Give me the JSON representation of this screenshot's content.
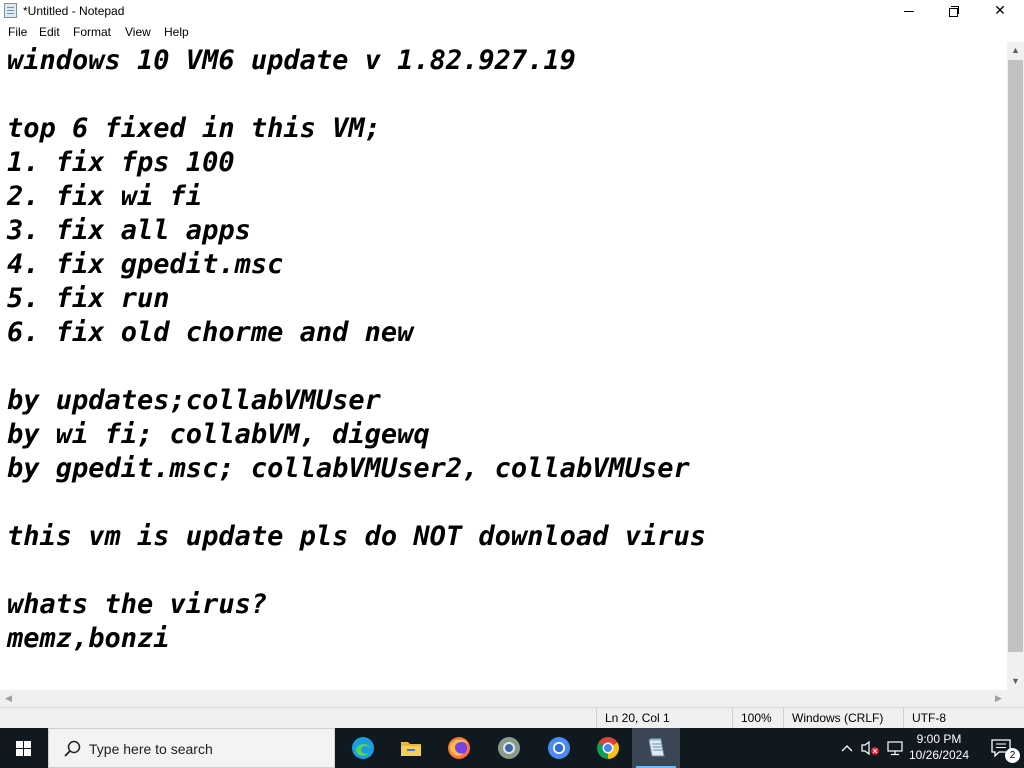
{
  "window": {
    "title": "*Untitled - Notepad",
    "controls": {
      "minimize": "minimize",
      "restore": "restore",
      "close": "close"
    }
  },
  "menu": {
    "items": [
      "File",
      "Edit",
      "Format",
      "View",
      "Help"
    ]
  },
  "editor": {
    "content": "windows 10 VM6 update v 1.82.927.19\n\ntop 6 fixed in this VM;\n1. fix fps 100\n2. fix wi fi\n3. fix all apps\n4. fix gpedit.msc\n5. fix run\n6. fix old chorme and new\n\nby updates;collabVMUser\nby wi fi; collabVM, digewq\nby gpedit.msc; collabVMUser2, collabVMUser\n\nthis vm is update pls do NOT download virus\n\nwhats the virus?\nmemz,bonzi"
  },
  "statusbar": {
    "position": "Ln 20, Col 1",
    "zoom": "100%",
    "line_ending": "Windows (CRLF)",
    "encoding": "UTF-8"
  },
  "taskbar": {
    "search_placeholder": "Type here to search",
    "apps": [
      {
        "name": "Microsoft Edge",
        "icon": "edge-icon",
        "active": false
      },
      {
        "name": "File Explorer",
        "icon": "folder-icon",
        "active": false
      },
      {
        "name": "Firefox",
        "icon": "firefox-icon",
        "active": false
      },
      {
        "name": "Chrome (old)",
        "icon": "chrome-old-icon",
        "active": false
      },
      {
        "name": "Chromium",
        "icon": "chromium-icon",
        "active": false
      },
      {
        "name": "Google Chrome",
        "icon": "chrome-icon",
        "active": false
      },
      {
        "name": "Notepad",
        "icon": "notepad-icon",
        "active": true
      }
    ],
    "clock": {
      "time": "9:00 PM",
      "date": "10/26/2024"
    },
    "notification_count": "2"
  },
  "colors": {
    "taskbar_bg": "#101820",
    "statusbar_bg": "#f0f0f0",
    "accent": "#0078d7"
  }
}
